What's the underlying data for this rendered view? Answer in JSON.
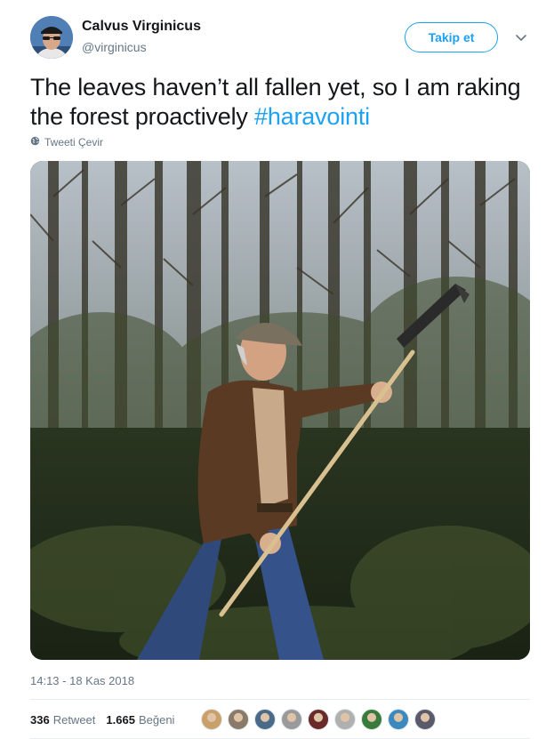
{
  "author": {
    "display_name": "Calvus Virginicus",
    "handle": "@virginicus",
    "avatar_icon": "user-avatar"
  },
  "actions": {
    "follow_label": "Takip et",
    "more_icon": "chevron-down-icon"
  },
  "tweet": {
    "text": "The leaves haven’t all fallen yet, so I am raking the forest proactively",
    "hashtag": "#haravointi",
    "translate_label": "Tweeti Çevir",
    "translate_icon": "globe-icon",
    "timestamp": "14:13 - 18 Kas 2018"
  },
  "media": {
    "description_icon": "photo-man-with-rake-in-forest"
  },
  "stats": {
    "retweet_count": "336",
    "retweet_label": "Retweet",
    "like_count": "1.665",
    "like_label": "Beğeni"
  },
  "likers": [
    {
      "color": "#c9a06a"
    },
    {
      "color": "#8a7a6a"
    },
    {
      "color": "#4a6a8a"
    },
    {
      "color": "#9a9a9a"
    },
    {
      "color": "#6a2a2a"
    },
    {
      "color": "#b0b0b0"
    },
    {
      "color": "#3a7a3a"
    },
    {
      "color": "#3a8ac0"
    },
    {
      "color": "#5a5a6a"
    }
  ],
  "colors": {
    "accent": "#1da1f2",
    "text": "#14171a",
    "secondary": "#657786"
  }
}
